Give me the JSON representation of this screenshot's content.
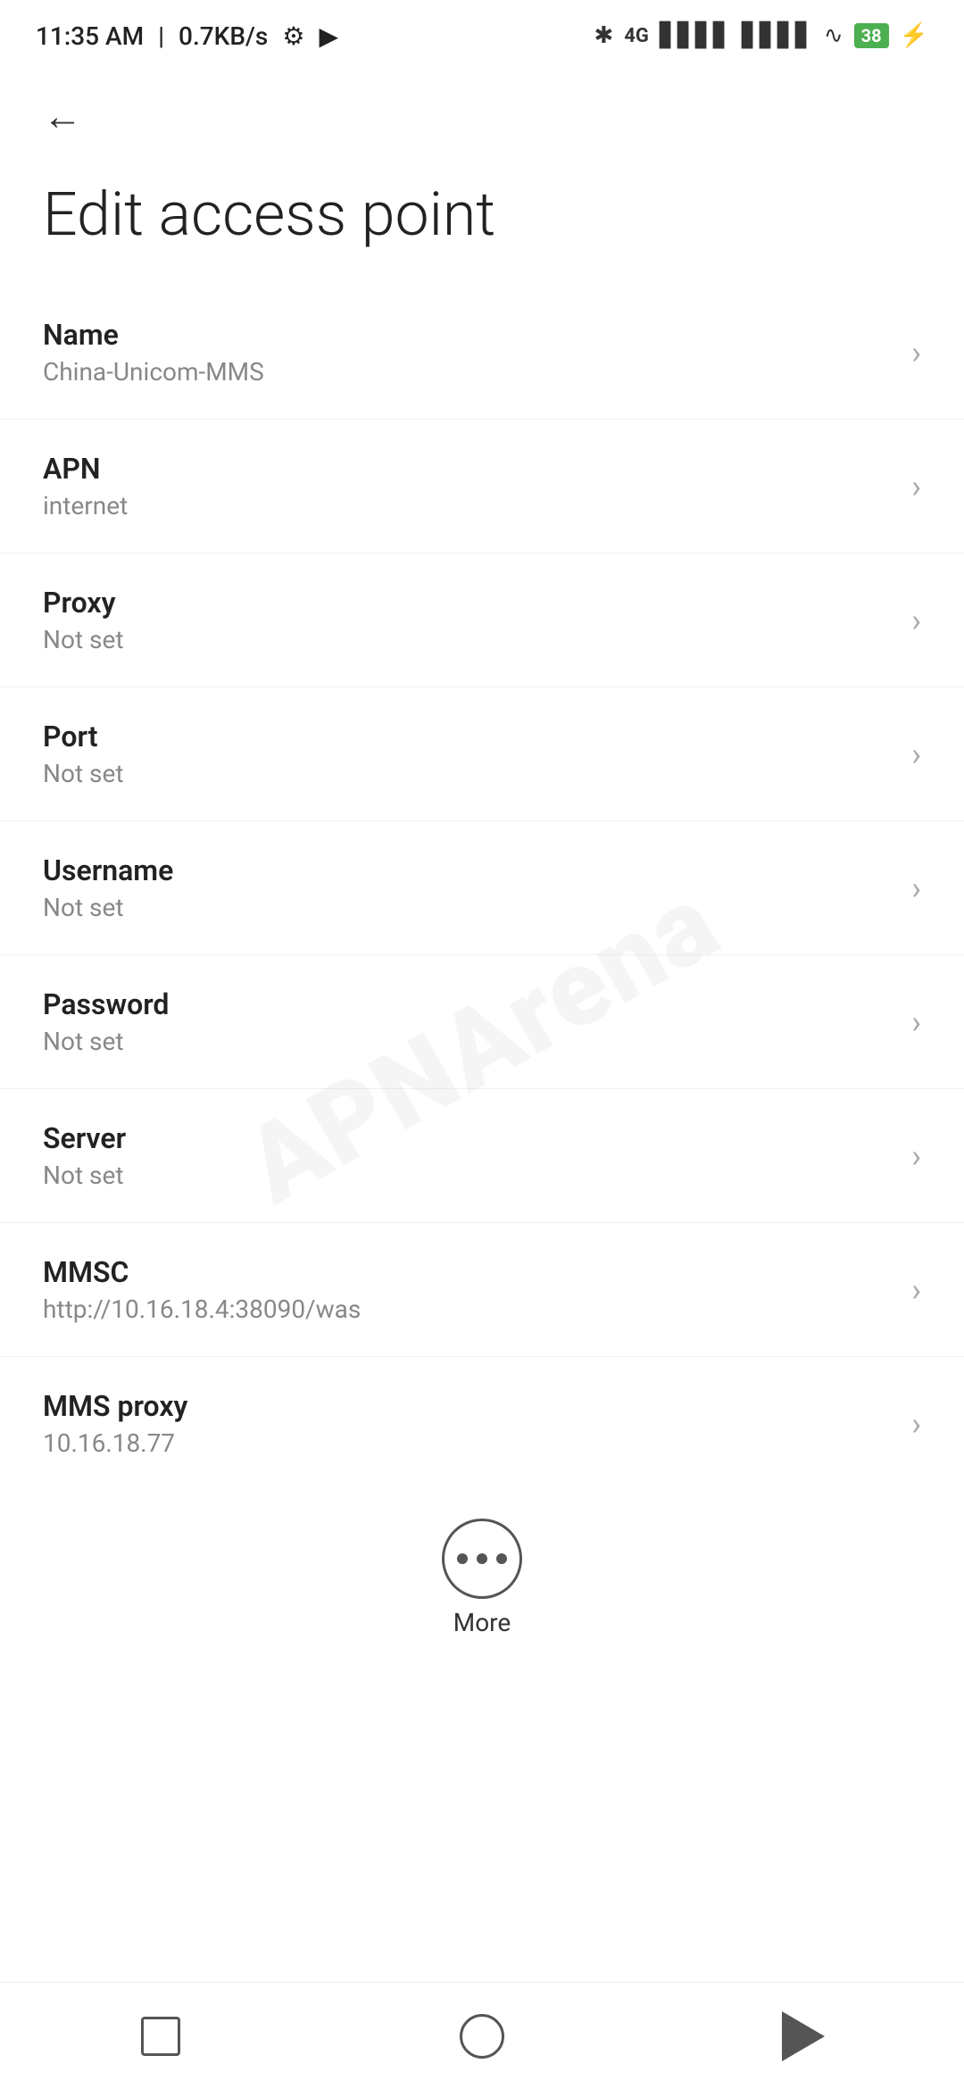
{
  "statusBar": {
    "time": "11:35 AM",
    "speed": "0.7KB/s",
    "battery": "38"
  },
  "toolbar": {
    "backLabel": "←"
  },
  "page": {
    "title": "Edit access point"
  },
  "settings": [
    {
      "label": "Name",
      "value": "China-Unicom-MMS"
    },
    {
      "label": "APN",
      "value": "internet"
    },
    {
      "label": "Proxy",
      "value": "Not set"
    },
    {
      "label": "Port",
      "value": "Not set"
    },
    {
      "label": "Username",
      "value": "Not set"
    },
    {
      "label": "Password",
      "value": "Not set"
    },
    {
      "label": "Server",
      "value": "Not set"
    },
    {
      "label": "MMSC",
      "value": "http://10.16.18.4:38090/was"
    },
    {
      "label": "MMS proxy",
      "value": "10.16.18.77"
    }
  ],
  "more": {
    "label": "More"
  },
  "watermark": "APNArena",
  "nav": {
    "recentLabel": "recent",
    "homeLabel": "home",
    "backLabel": "back"
  }
}
